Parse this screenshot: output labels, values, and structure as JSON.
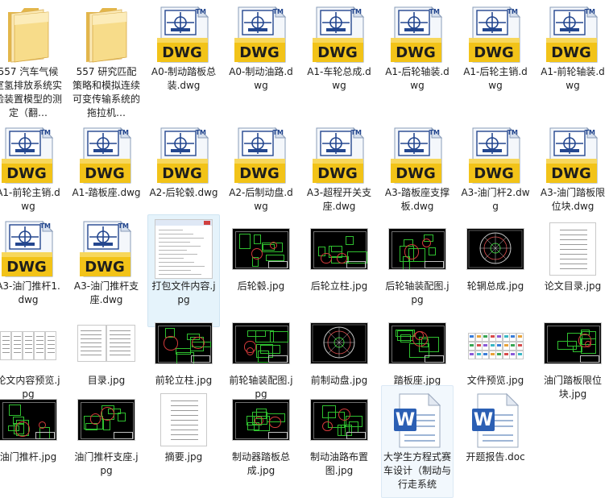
{
  "files": [
    {
      "name": "557 汽车气候室氢排放系统实验装置模型的测定（翻…",
      "kind": "folder"
    },
    {
      "name": "557 研究匹配策略和模拟连续可变传输系统的拖拉机…",
      "kind": "folder"
    },
    {
      "name": "A0-制动踏板总装.dwg",
      "kind": "dwg"
    },
    {
      "name": "A0-制动油路.dwg",
      "kind": "dwg"
    },
    {
      "name": "A1-车轮总成.dwg",
      "kind": "dwg"
    },
    {
      "name": "A1-后轮轴装.dwg",
      "kind": "dwg"
    },
    {
      "name": "A1-后轮主销.dwg",
      "kind": "dwg"
    },
    {
      "name": "A1-前轮轴装.dwg",
      "kind": "dwg"
    },
    {
      "name": "A1-前轮主销.dwg",
      "kind": "dwg"
    },
    {
      "name": "A1-踏板座.dwg",
      "kind": "dwg"
    },
    {
      "name": "A2-后轮毂.dwg",
      "kind": "dwg"
    },
    {
      "name": "A2-后制动盘.dwg",
      "kind": "dwg"
    },
    {
      "name": "A3-超程开关支座.dwg",
      "kind": "dwg"
    },
    {
      "name": "A3-踏板座支撑板.dwg",
      "kind": "dwg"
    },
    {
      "name": "A3-油门杆2.dwg",
      "kind": "dwg"
    },
    {
      "name": "A3-油门踏板限位块.dwg",
      "kind": "dwg"
    },
    {
      "name": "A3-油门推杆1.dwg",
      "kind": "dwg"
    },
    {
      "name": "A3-油门推杆支座.dwg",
      "kind": "dwg"
    },
    {
      "name": "打包文件内容.jpg",
      "kind": "listing"
    },
    {
      "name": "后轮毂.jpg",
      "kind": "cad"
    },
    {
      "name": "后轮立柱.jpg",
      "kind": "cad"
    },
    {
      "name": "后轮轴装配图.jpg",
      "kind": "cad"
    },
    {
      "name": "轮辋总成.jpg",
      "kind": "wheel"
    },
    {
      "name": "论文目录.jpg",
      "kind": "doc"
    },
    {
      "name": "论文内容预览.jpg",
      "kind": "doc-multi"
    },
    {
      "name": "目录.jpg",
      "kind": "doc-spread"
    },
    {
      "name": "前轮立柱.jpg",
      "kind": "cad"
    },
    {
      "name": "前轮轴装配图.jpg",
      "kind": "cad"
    },
    {
      "name": "前制动盘.jpg",
      "kind": "wheel"
    },
    {
      "name": "踏板座.jpg",
      "kind": "cad"
    },
    {
      "name": "文件预览.jpg",
      "kind": "tiles"
    },
    {
      "name": "油门踏板限位块.jpg",
      "kind": "cad"
    },
    {
      "name": "油门推杆.jpg",
      "kind": "cad"
    },
    {
      "name": "油门推杆支座.jpg",
      "kind": "cad"
    },
    {
      "name": "摘要.jpg",
      "kind": "doc"
    },
    {
      "name": "制动器踏板总成.jpg",
      "kind": "cad"
    },
    {
      "name": "制动油路布置图.jpg",
      "kind": "cad"
    },
    {
      "name": "大学生方程式赛车设计（制动与行走系统",
      "kind": "word"
    },
    {
      "name": "开题报告.doc",
      "kind": "word"
    }
  ],
  "icons": {
    "dwg_badge": "DWG",
    "trademark": "TM",
    "word_letter": "W"
  },
  "colors": {
    "folder_light": "#f7dc8a",
    "folder_dark": "#e3b64a",
    "dwg_yellow": "#f2c318",
    "dwg_blue": "#24478f",
    "word_blue": "#2b5fb4",
    "selection": "#e5f3fb"
  }
}
